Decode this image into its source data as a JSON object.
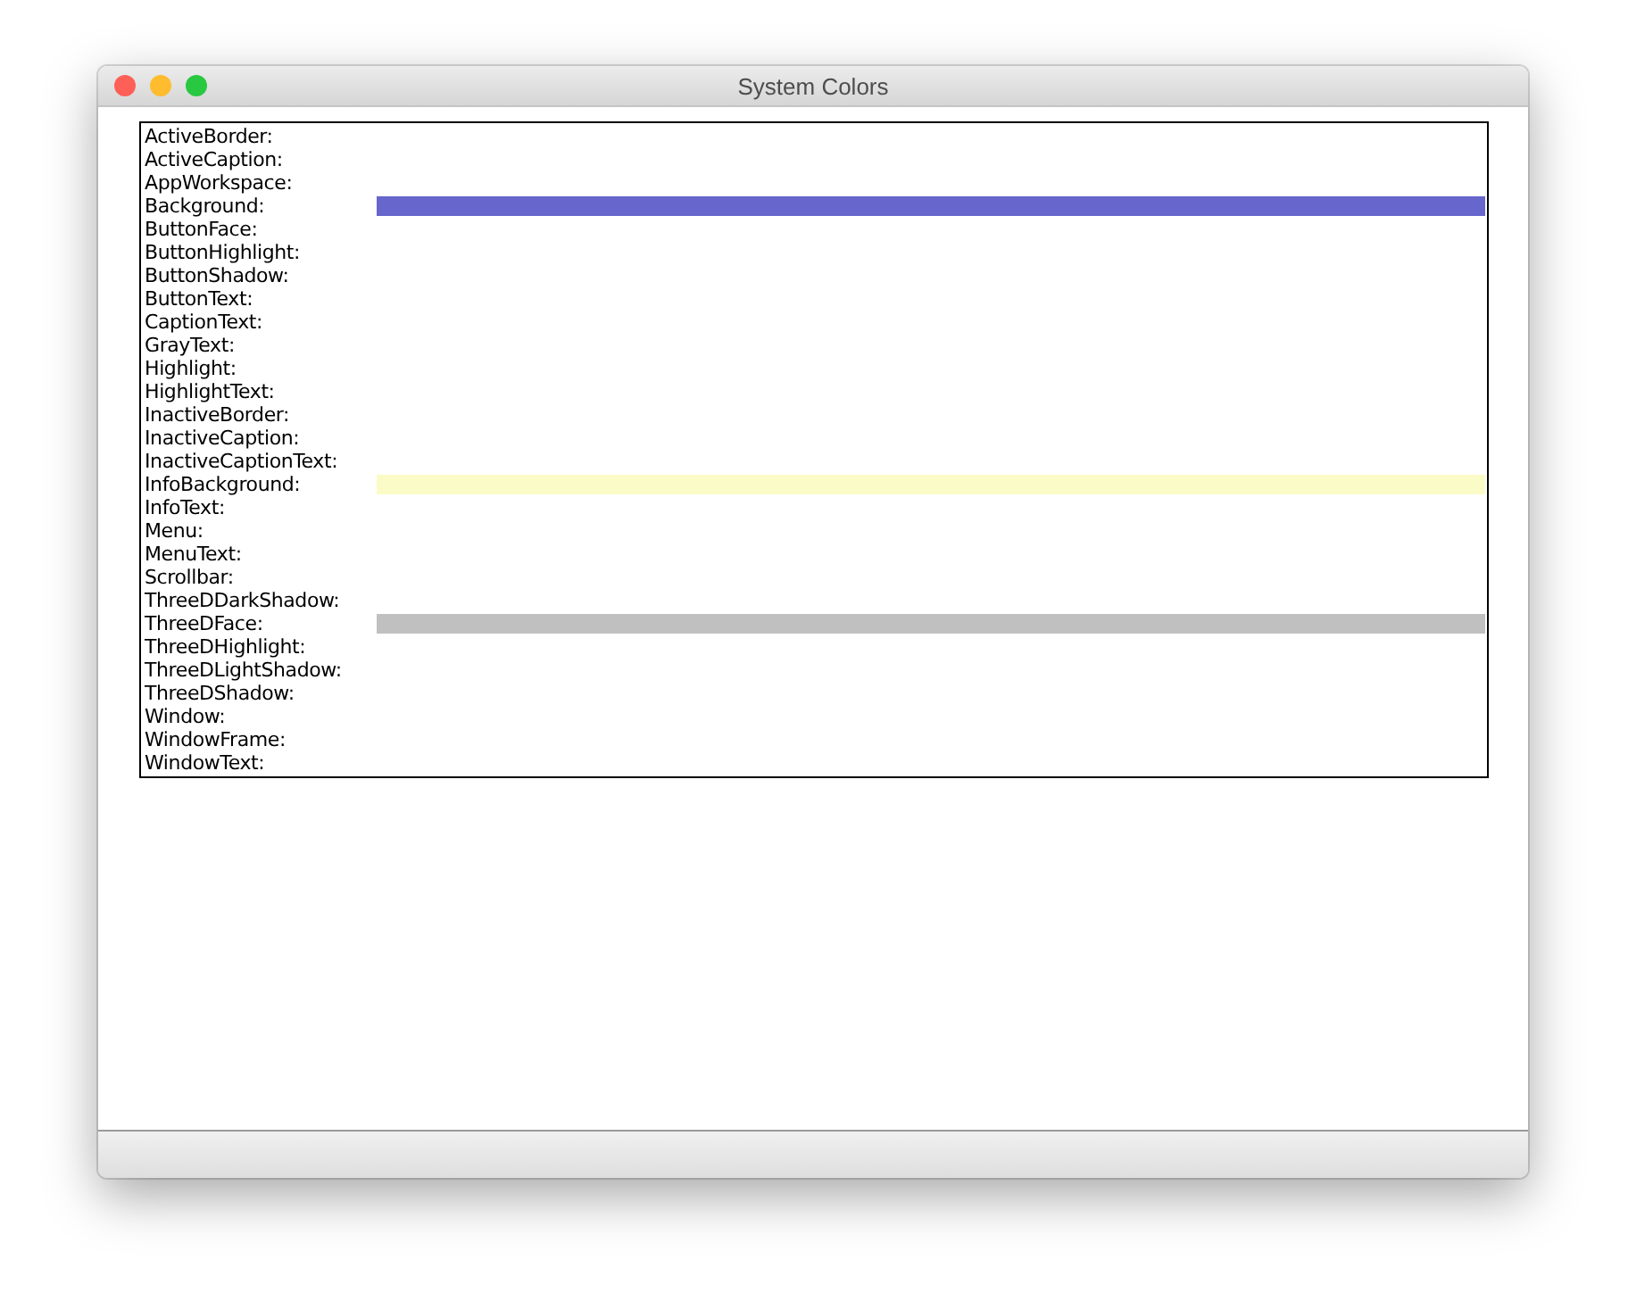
{
  "window": {
    "title": "System Colors"
  },
  "rows": [
    {
      "label": "ActiveBorder:"
    },
    {
      "label": "ActiveCaption:"
    },
    {
      "label": "AppWorkspace:"
    },
    {
      "label": "Background:",
      "color": "#6666cc"
    },
    {
      "label": "ButtonFace:"
    },
    {
      "label": "ButtonHighlight:"
    },
    {
      "label": "ButtonShadow:"
    },
    {
      "label": "ButtonText:"
    },
    {
      "label": "CaptionText:"
    },
    {
      "label": "GrayText:"
    },
    {
      "label": "Highlight:"
    },
    {
      "label": "HighlightText:"
    },
    {
      "label": "InactiveBorder:"
    },
    {
      "label": "InactiveCaption:"
    },
    {
      "label": "InactiveCaptionText:"
    },
    {
      "label": "InfoBackground:",
      "color": "#fbfbc8"
    },
    {
      "label": "InfoText:"
    },
    {
      "label": "Menu:"
    },
    {
      "label": "MenuText:"
    },
    {
      "label": "Scrollbar:"
    },
    {
      "label": "ThreeDDarkShadow:"
    },
    {
      "label": "ThreeDFace:",
      "color": "#c0c0c0"
    },
    {
      "label": "ThreeDHighlight:"
    },
    {
      "label": "ThreeDLightShadow:"
    },
    {
      "label": "ThreeDShadow:"
    },
    {
      "label": "Window:"
    },
    {
      "label": "WindowFrame:"
    },
    {
      "label": "WindowText:"
    }
  ]
}
